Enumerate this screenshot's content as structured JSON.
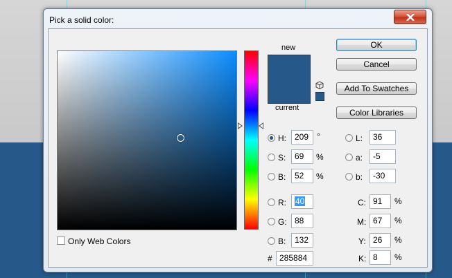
{
  "dialog": {
    "title": "Pick a solid color:",
    "new_label": "new",
    "current_label": "current",
    "color_hex_display": "#27588a"
  },
  "buttons": {
    "ok": "OK",
    "cancel": "Cancel",
    "add_to_swatches": "Add To Swatches",
    "color_libraries": "Color Libraries"
  },
  "hsb": {
    "h": {
      "label": "H:",
      "value": "209",
      "unit": "°"
    },
    "s": {
      "label": "S:",
      "value": "69",
      "unit": "%"
    },
    "b": {
      "label": "B:",
      "value": "52",
      "unit": "%"
    }
  },
  "rgb": {
    "r": {
      "label": "R:",
      "value": "40"
    },
    "g": {
      "label": "G:",
      "value": "88"
    },
    "b": {
      "label": "B:",
      "value": "132"
    }
  },
  "lab": {
    "l": {
      "label": "L:",
      "value": "36"
    },
    "a": {
      "label": "a:",
      "value": "-5"
    },
    "b": {
      "label": "b:",
      "value": "-30"
    }
  },
  "cmyk": {
    "c": {
      "label": "C:",
      "value": "91",
      "unit": "%"
    },
    "m": {
      "label": "M:",
      "value": "67",
      "unit": "%"
    },
    "y": {
      "label": "Y:",
      "value": "26",
      "unit": "%"
    },
    "k": {
      "label": "K:",
      "value": "8",
      "unit": "%"
    }
  },
  "hex": {
    "label": "#",
    "value": "285884"
  },
  "only_web_colors": {
    "label": "Only Web Colors",
    "checked": false
  },
  "icons": {
    "close": "close-icon",
    "gamut": "cube-icon"
  }
}
